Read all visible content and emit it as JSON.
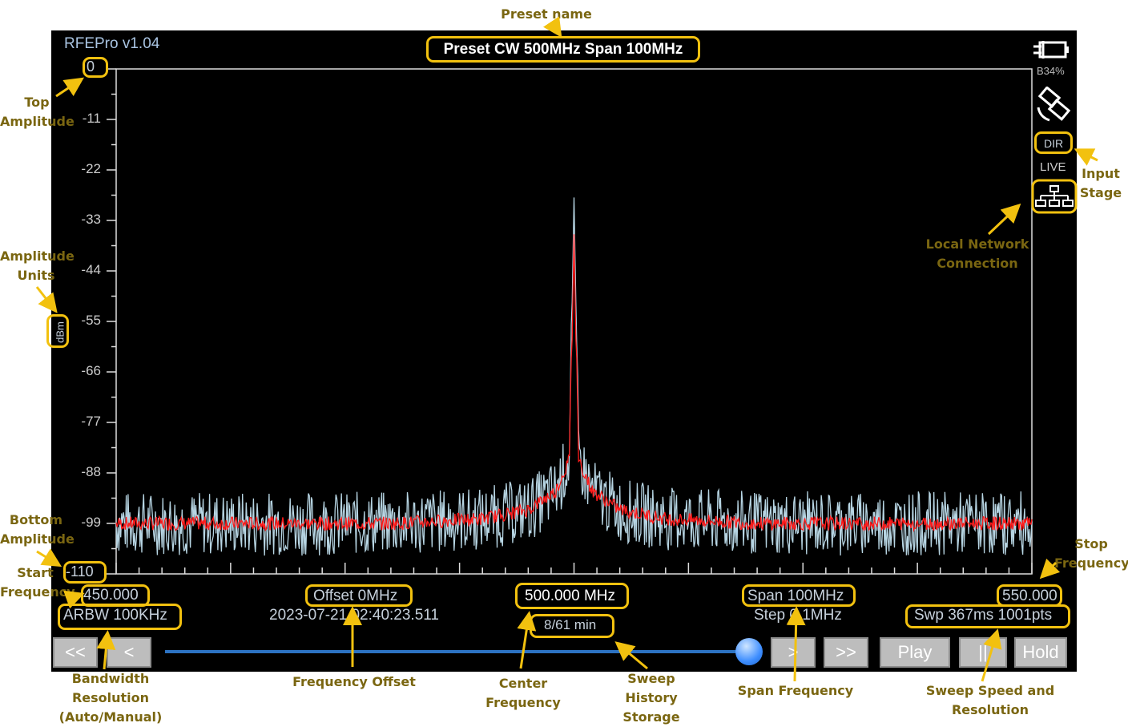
{
  "window": {
    "title": "RFEPro v1.04",
    "preset_name": "Preset CW 500MHz Span 100MHz"
  },
  "status": {
    "battery": "B34%",
    "input_stage": "DIR",
    "mode": "LIVE"
  },
  "axis": {
    "top_amplitude": "0",
    "bottom_amplitude": "-110",
    "units": "dBm",
    "tick_labels": [
      "-11",
      "-22",
      "-33",
      "-44",
      "-55",
      "-66",
      "-77",
      "-88",
      "-99"
    ]
  },
  "bottom_bar": {
    "start_frequency": "450.000",
    "stop_frequency": "550.000",
    "rbw": "ARBW 100KHz",
    "offset": "Offset 0MHz",
    "timestamp": "2023-07-21 02:40:23.511",
    "center_frequency": "500.000 MHz",
    "history": "8/61 min",
    "span": "Span 100MHz",
    "step": "Step 0.1MHz",
    "sweep": "Swp 367ms  1001pts"
  },
  "controls": {
    "first": "<<",
    "prev": "<",
    "next": ">",
    "last": ">>",
    "play": "Play",
    "pause": "||",
    "hold": "Hold",
    "slider_position": 0.98
  },
  "annotations": {
    "preset_name": "Preset name",
    "top_amplitude": "Top Amplitude",
    "amplitude_units": "Amplitude Units",
    "bottom_amplitude": "Bottom Amplitude",
    "start_frequency": "Start Frequency",
    "input_stage": "Input Stage",
    "local_network": "Local Network Connection",
    "stop_frequency": "Stop Frequency",
    "bandwidth_resolution": "Bandwidth Resolution (Auto/Manual)",
    "frequency_offset": "Frequency Offset",
    "center_frequency": "Center Frequency",
    "sweep_history": "Sweep History Storage",
    "span_frequency": "Span Frequency",
    "sweep_speed": "Sweep Speed and Resolution"
  },
  "colors": {
    "annotation": "#f2c10f",
    "trace_live": "#b7d5e3",
    "trace_avg": "#ff1a1a",
    "slider": "#2c72c2"
  },
  "chart_data": {
    "type": "line",
    "x_range": [
      450,
      550
    ],
    "ylim": [
      -110,
      0
    ],
    "series": [
      {
        "x": [
          450,
          480,
          490,
          495,
          498,
          499.5,
          500,
          500.5,
          502,
          505,
          510,
          520,
          550
        ],
        "y": [
          -99,
          -99,
          -98,
          -96,
          -92,
          -85,
          -28,
          -85,
          -92,
          -96,
          -98,
          -99,
          -99
        ]
      }
    ]
  }
}
